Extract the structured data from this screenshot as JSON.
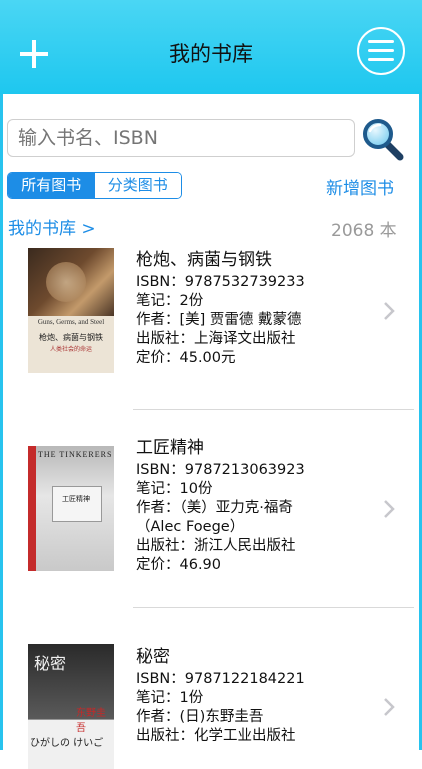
{
  "header": {
    "title": "我的书库",
    "add_icon": "plus-icon",
    "menu_icon": "menu-icon"
  },
  "search": {
    "placeholder": "输入书名、ISBN",
    "value": "",
    "button_icon": "magnifier-icon"
  },
  "tabs": [
    {
      "label": "所有图书",
      "active": true
    },
    {
      "label": "分类图书",
      "active": false
    }
  ],
  "add_book_label": "新增图书",
  "breadcrumb": "我的书库 >",
  "count_label": "2068 本",
  "colors": {
    "accent": "#1d8de6",
    "header": "#2bcaf0"
  },
  "books": [
    {
      "title": "枪炮、病菌与钢铁",
      "isbn": "ISBN：9787532739233",
      "notes": "笔记：2份",
      "author": "作者：[美] 贾雷德 戴蒙德",
      "author_cont": "",
      "publisher": "出版社：上海译文出版社",
      "price": "定价：45.00元",
      "cover": {
        "line1": "Guns, Germs, and Steel",
        "line2": "枪炮、病菌与钢铁",
        "line3": "人类社会的命运"
      }
    },
    {
      "title": "工匠精神",
      "isbn": "ISBN：9787213063923",
      "notes": "笔记：10份",
      "author": "作者：（美）亚力克·福奇",
      "author_cont": "（Alec Foege）",
      "publisher": "出版社：浙江人民出版社",
      "price": "定价：46.90",
      "cover": {
        "line1": "THE TINKERERS",
        "line2": "工匠精神"
      }
    },
    {
      "title": "秘密",
      "isbn": "ISBN：9787122184221",
      "notes": "笔记：1份",
      "author": "作者：(日)东野圭吾",
      "author_cont": "",
      "publisher": "出版社：化学工业出版社",
      "price": "",
      "cover": {
        "line1": "秘密",
        "line2": "东野圭吾",
        "line3": "ひがしの けいご"
      }
    }
  ]
}
